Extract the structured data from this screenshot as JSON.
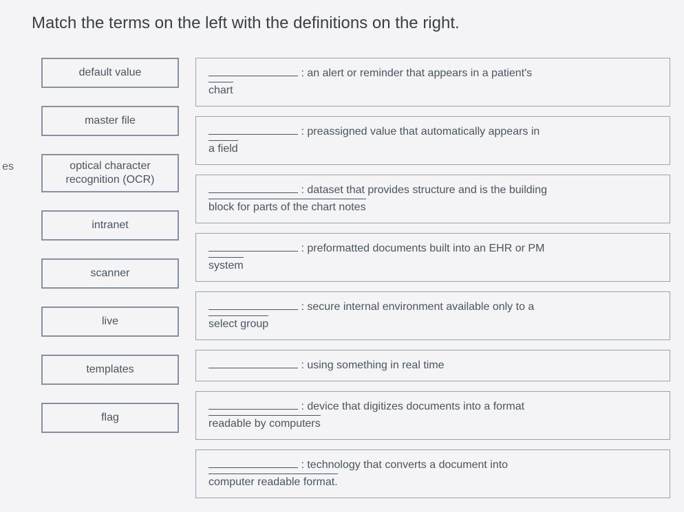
{
  "title": "Match the terms on the left with the definitions on the right.",
  "left_fragment": "es",
  "terms": [
    {
      "label": "default value"
    },
    {
      "label": "master file"
    },
    {
      "label": "optical character recognition (OCR)"
    },
    {
      "label": "intranet"
    },
    {
      "label": "scanner"
    },
    {
      "label": "live"
    },
    {
      "label": "templates"
    },
    {
      "label": "flag"
    }
  ],
  "definitions": [
    {
      "lead": "",
      "text": "an alert or reminder that appears in a patient's",
      "wrap": "chart"
    },
    {
      "lead": "",
      "text": "preassigned value that automatically appears in",
      "wrap": "a field"
    },
    {
      "lead": "",
      "text": "dataset that provides structure and is the building",
      "wrap": "block for parts of the chart notes"
    },
    {
      "lead": "",
      "text": "preformatted documents built into an EHR or PM",
      "wrap": "system"
    },
    {
      "lead": "",
      "text": "secure internal environment available only to a",
      "wrap": "select group"
    },
    {
      "lead": "",
      "text": "using something in real time",
      "wrap": ""
    },
    {
      "lead": "",
      "text": "device that digitizes documents into a format",
      "wrap": "readable by computers"
    },
    {
      "lead": "",
      "text": "technology that converts a document into",
      "wrap": "computer readable format."
    }
  ]
}
